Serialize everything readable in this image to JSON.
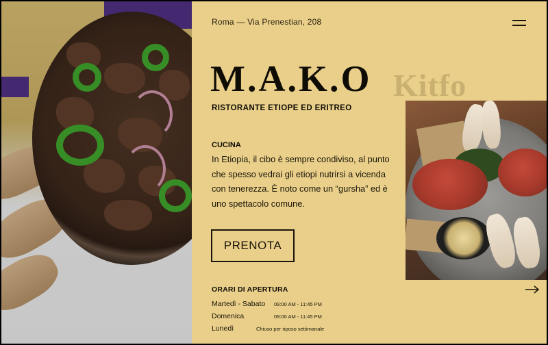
{
  "header": {
    "address": "Roma — Via Prenestian, 208",
    "menu_icon": "hamburger-menu-icon"
  },
  "brand": {
    "name": "M.A.K.O",
    "subtitle": "RISTORANTE ETIOPE ED ERITREO"
  },
  "dish": {
    "name": "Kitfo"
  },
  "cucina": {
    "title": "CUCINA",
    "text": "In Etiopia, il cibo è sempre condiviso, al punto che spesso vedrai gli etiopi nutrirsi a vicenda con tenerezza. È noto come un “gursha” ed è uno spettacolo comune."
  },
  "reserve": {
    "label": "PRENOTA"
  },
  "hours": {
    "title": "ORARI DI APERTURA",
    "rows": [
      {
        "day": "Martedì - Sabato",
        "time": "09:00 AM - 11:45 PM"
      },
      {
        "day": "Domenica",
        "time": "09:00 AM - 11:45 PM"
      },
      {
        "day": "Lunedì",
        "time": "Chiuso per riposo settimanale"
      }
    ],
    "next_icon": "arrow-right-icon"
  },
  "colors": {
    "background": "#e9cf8a",
    "text": "#1a1508",
    "watermark": "#c9b070",
    "accent_green": "#3c9a2a"
  },
  "images": {
    "hero": "ethiopian-beef-tibs-pan-photo",
    "food": "kitfo-platter-photo"
  }
}
